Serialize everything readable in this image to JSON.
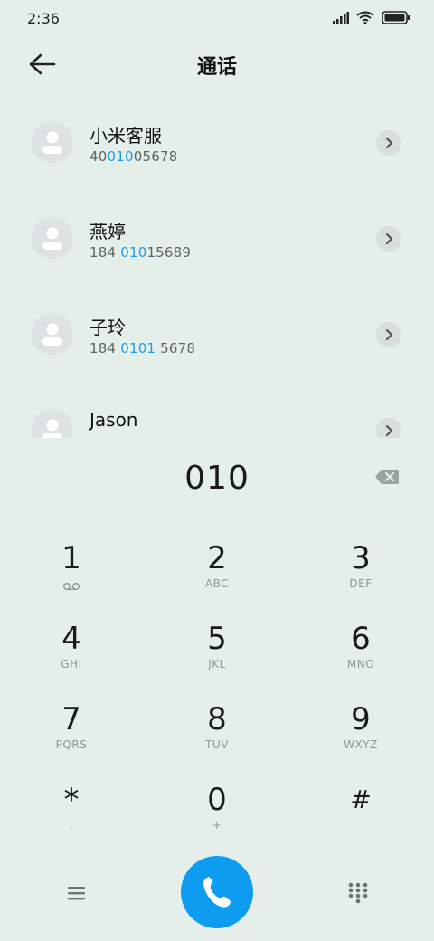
{
  "status": {
    "time": "2:36"
  },
  "header": {
    "title": "通话"
  },
  "contacts": [
    {
      "name": "小米客服",
      "num_pre": "40",
      "num_hl": "010",
      "num_post": "05678"
    },
    {
      "name": "燕婷",
      "num_pre": "184 ",
      "num_hl": "010",
      "num_post": "15689"
    },
    {
      "name": "子玲",
      "num_pre": "184 ",
      "num_hl": "0101",
      "num_post": " 5678"
    },
    {
      "name": "Jason",
      "num_pre": "",
      "num_hl": "",
      "num_post": ""
    }
  ],
  "dial": {
    "digits": "010"
  },
  "keys": [
    {
      "main": "1",
      "sub": ""
    },
    {
      "main": "2",
      "sub": "ABC"
    },
    {
      "main": "3",
      "sub": "DEF"
    },
    {
      "main": "4",
      "sub": "GHI"
    },
    {
      "main": "5",
      "sub": "JKL"
    },
    {
      "main": "6",
      "sub": "MNO"
    },
    {
      "main": "7",
      "sub": "PQRS"
    },
    {
      "main": "8",
      "sub": "TUV"
    },
    {
      "main": "9",
      "sub": "WXYZ"
    },
    {
      "main": "*",
      "sub": ","
    },
    {
      "main": "0",
      "sub": "+"
    },
    {
      "main": "#",
      "sub": ""
    }
  ],
  "colors": {
    "accent": "#0d9cf0",
    "highlight": "#1b9ae6",
    "background": "#e4efea"
  },
  "icons": {
    "back": "back-arrow-icon",
    "backspace": "backspace-icon",
    "voicemail": "voicemail-icon",
    "menu": "menu-icon",
    "call": "phone-icon",
    "dialpad": "dialpad-icon"
  }
}
